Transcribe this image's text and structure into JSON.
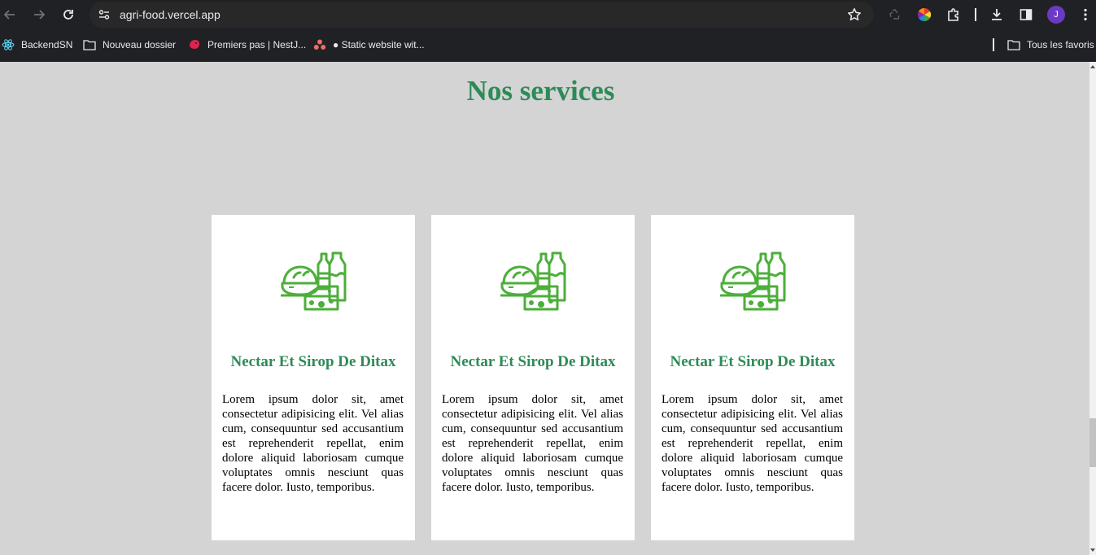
{
  "browser": {
    "url": "agri-food.vercel.app",
    "profile_initial": "J",
    "bookmarks": [
      {
        "label": "BackendSN",
        "icon": "react-icon"
      },
      {
        "label": "Nouveau dossier",
        "icon": "folder-icon"
      },
      {
        "label": "Premiers pas | NestJ...",
        "icon": "nestjs-icon"
      },
      {
        "label": "● Static website wit...",
        "icon": "asana-icon"
      }
    ],
    "all_bookmarks_label": "Tous les favoris"
  },
  "page": {
    "section_title": "Nos services",
    "cards": [
      {
        "title": "Nectar Et Sirop De Ditax",
        "text": "Lorem ipsum dolor sit, amet consectetur adipisicing elit. Vel alias cum, consequuntur sed accusantium est reprehenderit repellat, enim dolore aliquid laboriosam cumque voluptates omnis nesciunt quas facere dolor. Iusto, temporibus.",
        "icon": "food-products-icon"
      },
      {
        "title": "Nectar Et Sirop De Ditax",
        "text": "Lorem ipsum dolor sit, amet consectetur adipisicing elit. Vel alias cum, consequuntur sed accusantium est reprehenderit repellat, enim dolore aliquid laboriosam cumque voluptates omnis nesciunt quas facere dolor. Iusto, temporibus.",
        "icon": "food-products-icon"
      },
      {
        "title": "Nectar Et Sirop De Ditax",
        "text": "Lorem ipsum dolor sit, amet consectetur adipisicing elit. Vel alias cum, consequuntur sed accusantium est reprehenderit repellat, enim dolore aliquid laboriosam cumque voluptates omnis nesciunt quas facere dolor. Iusto, temporibus.",
        "icon": "food-products-icon"
      }
    ]
  },
  "colors": {
    "title_green": "#2e8b57",
    "icon_green": "#4caf3a",
    "page_background": "#d4d4d4",
    "card_background": "#ffffff",
    "chrome_dark": "#202124"
  }
}
